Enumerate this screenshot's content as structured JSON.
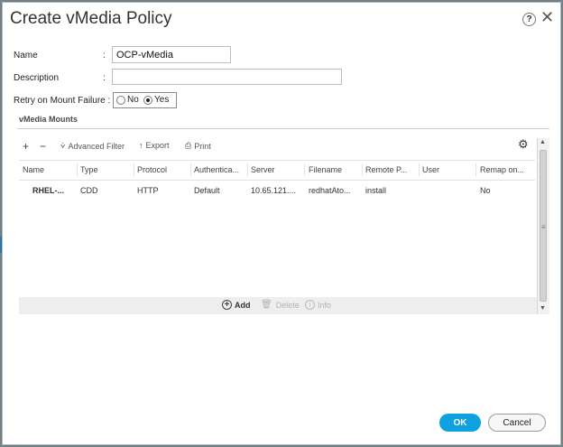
{
  "dialog": {
    "title": "Create vMedia Policy",
    "help_glyph": "?",
    "close_glyph": "✕"
  },
  "form": {
    "name_label": "Name",
    "name_value": "OCP-vMedia",
    "description_label": "Description",
    "description_value": "",
    "retry_label": "Retry on Mount Failure :",
    "retry_options": [
      {
        "label": "No",
        "selected": false
      },
      {
        "label": "Yes",
        "selected": true
      }
    ],
    "colon": ":"
  },
  "mounts": {
    "section_title": "vMedia Mounts",
    "toolbar": {
      "add_glyph": "+",
      "remove_glyph": "−",
      "advanced_filter": "Advanced Filter",
      "export": "Export",
      "print": "Print",
      "settings_icon": "gear-icon"
    },
    "columns": [
      "Name",
      "Type",
      "Protocol",
      "Authentica...",
      "Server",
      "Filename",
      "Remote P...",
      "User",
      "Remap on..."
    ],
    "rows": [
      {
        "name": "RHEL-...",
        "type": "CDD",
        "protocol": "HTTP",
        "auth": "Default",
        "server": "10.65.121....",
        "filename": "redhatAto...",
        "remote_path": "install",
        "user": "",
        "remap": "No"
      }
    ],
    "footer": {
      "add": "Add",
      "delete": "Delete",
      "info": "Info"
    }
  },
  "buttons": {
    "ok": "OK",
    "cancel": "Cancel"
  },
  "colors": {
    "accent": "#0fa0df",
    "backdrop": "#7c8a93"
  }
}
